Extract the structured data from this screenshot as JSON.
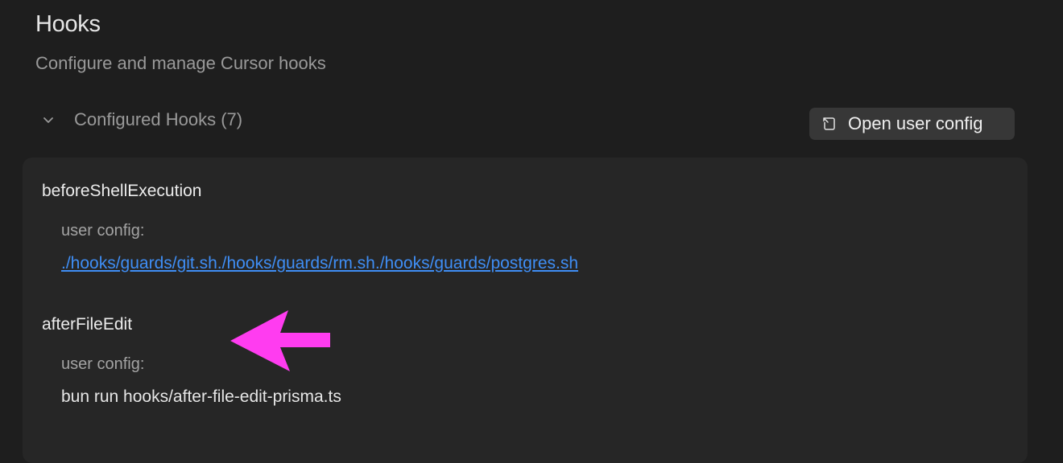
{
  "header": {
    "title": "Hooks",
    "subtitle": "Configure and manage Cursor hooks"
  },
  "section": {
    "title": "Configured Hooks (7)",
    "toggle_icon": "chevron-down-icon"
  },
  "toolbar": {
    "open_user_config_label": "Open user config",
    "open_user_config_icon": "file-open-icon"
  },
  "hooks": [
    {
      "name": "beforeShellExecution",
      "scope_label": "user config:",
      "command": "./hooks/guards/git.sh./hooks/guards/rm.sh./hooks/guards/postgres.sh"
    },
    {
      "name": "afterFileEdit",
      "scope_label": "user config:",
      "command": "bun run hooks/after-file-edit-prisma.ts"
    }
  ],
  "annotation": {
    "arrow_color": "#ff3cf0"
  }
}
